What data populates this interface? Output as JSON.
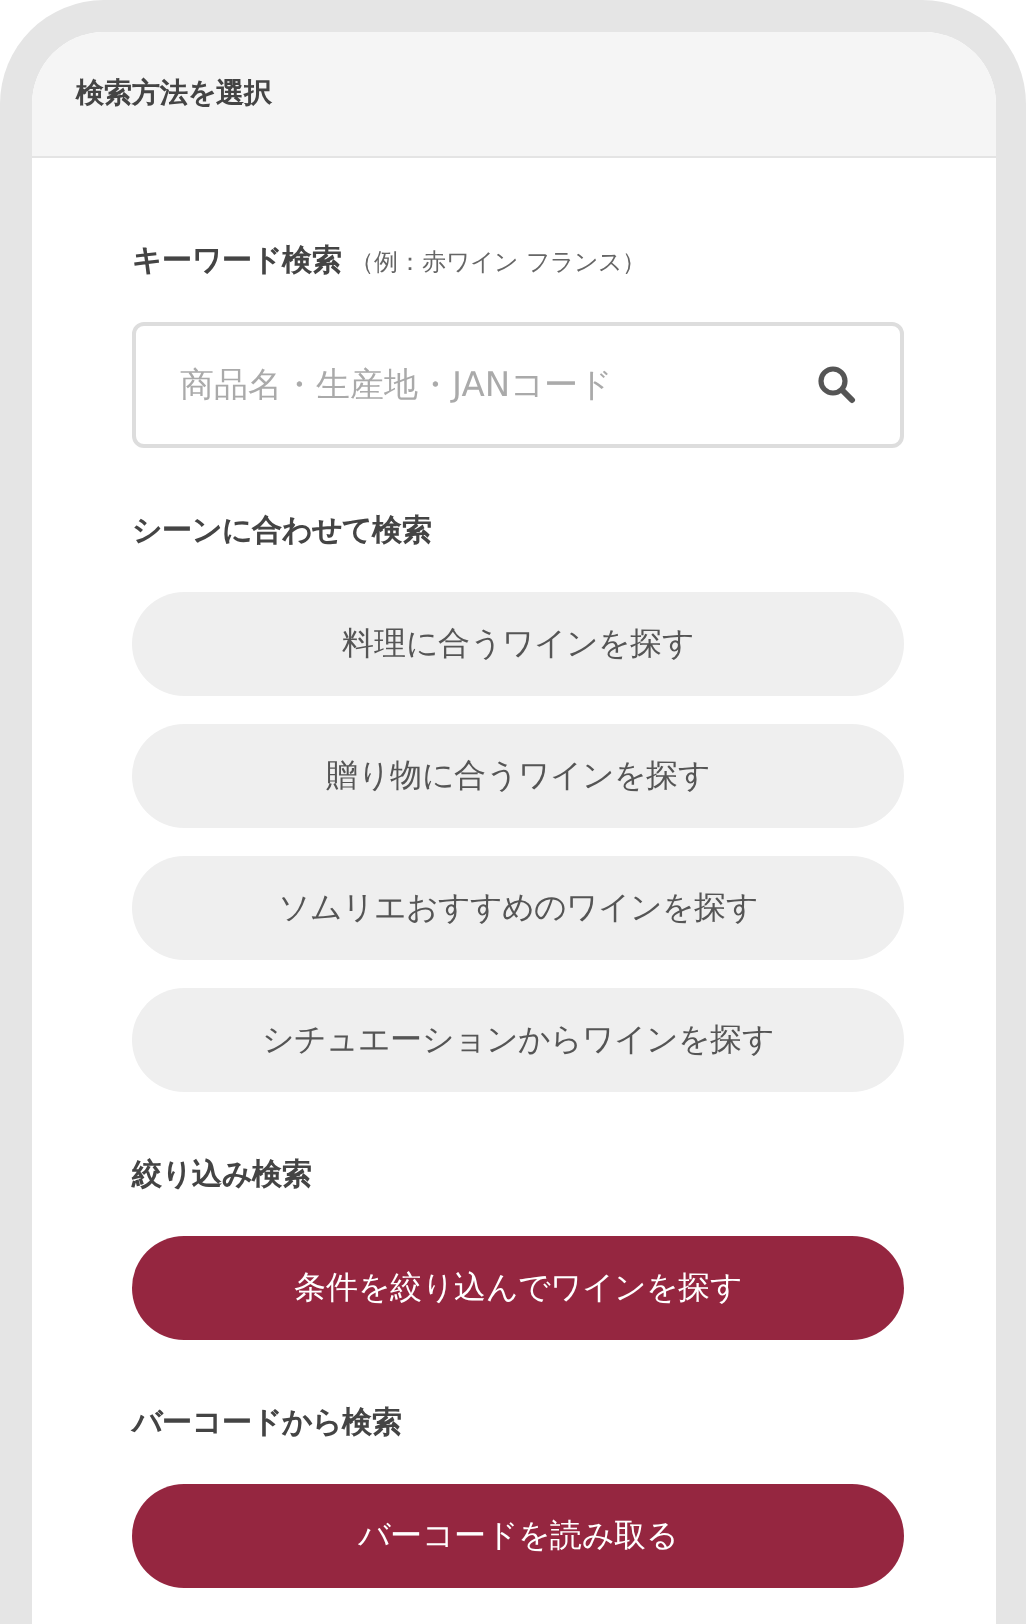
{
  "header": {
    "title": "検索方法を選択"
  },
  "sections": [
    {
      "kind": "search",
      "label": "キーワード検索",
      "hint": "（例：赤ワイン フランス）",
      "placeholder": "商品名・生産地・JANコード"
    },
    {
      "kind": "buttons",
      "label": "シーンに合わせて検索",
      "buttons": [
        {
          "label": "料理に合うワインを探す",
          "kind": "secondary"
        },
        {
          "label": "贈り物に合うワインを探す",
          "kind": "secondary"
        },
        {
          "label": "ソムリエおすすめのワインを探す",
          "kind": "secondary"
        },
        {
          "label": "シチュエーションからワインを探す",
          "kind": "secondary"
        }
      ]
    },
    {
      "kind": "buttons",
      "label": "絞り込み検索",
      "buttons": [
        {
          "label": "条件を絞り込んでワインを探す",
          "kind": "primary"
        }
      ]
    },
    {
      "kind": "buttons",
      "label": "バーコードから検索",
      "buttons": [
        {
          "label": "バーコードを読み取る",
          "kind": "primary"
        }
      ]
    }
  ]
}
